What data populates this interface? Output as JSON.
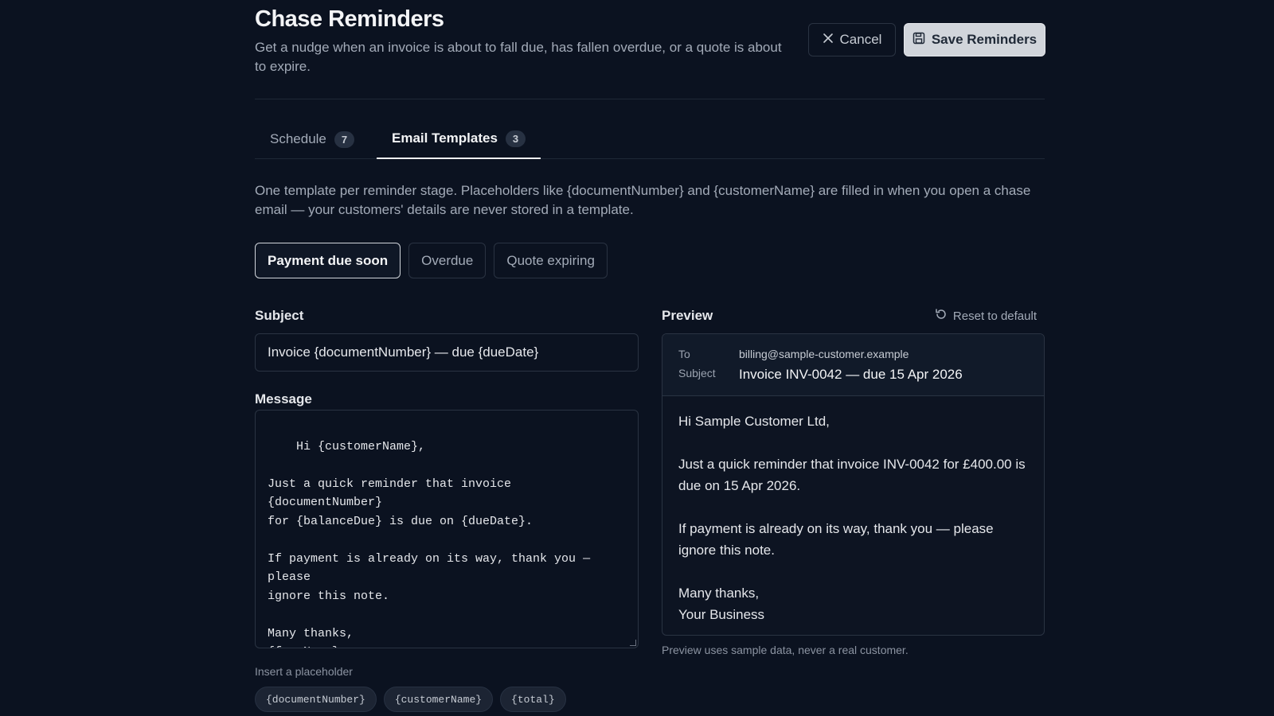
{
  "header": {
    "title": "Chase Reminders",
    "description": "Get a nudge when an invoice is about to fall due, has fallen overdue, or a quote is about to expire.",
    "cancel_label": "Cancel",
    "save_label": "Save Reminders"
  },
  "tabs": [
    {
      "label": "Schedule",
      "count": "7",
      "active": false
    },
    {
      "label": "Email Templates",
      "count": "3",
      "active": true
    }
  ],
  "intro": "One template per reminder stage. Placeholders like {documentNumber} and {customerName} are filled in when you open a chase email — your customers' details are never stored in a template.",
  "stages": [
    {
      "label": "Payment due soon",
      "active": true
    },
    {
      "label": "Overdue",
      "active": false
    },
    {
      "label": "Quote expiring",
      "active": false
    }
  ],
  "editor": {
    "subject_label": "Subject",
    "subject_value": "Invoice {documentNumber} — due {dueDate}",
    "message_label": "Message",
    "message_value": "Hi {customerName},\n\nJust a quick reminder that invoice {documentNumber}\nfor {balanceDue} is due on {dueDate}.\n\nIf payment is already on its way, thank you — please\nignore this note.\n\nMany thanks,\n{fromName}",
    "insert_label": "Insert a placeholder",
    "placeholders": [
      "{documentNumber}",
      "{customerName}",
      "{total}"
    ]
  },
  "preview": {
    "label": "Preview",
    "reset_label": "Reset to default",
    "to_label": "To",
    "to_value": "billing@sample-customer.example",
    "subject_label": "Subject",
    "subject_value": "Invoice INV-0042 — due 15 Apr 2026",
    "body": [
      "Hi Sample Customer Ltd,",
      "Just a quick reminder that invoice INV-0042 for £400.00 is due on 15 Apr 2026.",
      "If payment is already on its way, thank you — please ignore this note.",
      "Many thanks,\nYour Business"
    ],
    "note": "Preview uses sample data, never a real customer."
  },
  "icons": {
    "cancel": "close-icon",
    "save": "save-icon",
    "reset": "reset-icon"
  },
  "colors": {
    "background": "#0b1220",
    "accent_button": "#d1d5db",
    "border": "#2a3342"
  }
}
